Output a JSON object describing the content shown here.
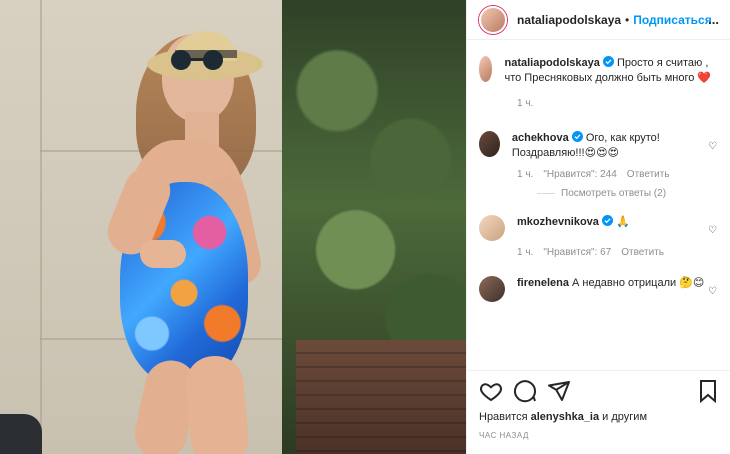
{
  "header": {
    "username": "nataliapodolskaya",
    "separator": "•",
    "follow_label": "Подписаться",
    "more": "..."
  },
  "caption": {
    "username": "nataliapodolskaya",
    "text": "Просто я считаю , что Пресняковых должно быть много ❤️",
    "time": "1 ч."
  },
  "comments": [
    {
      "username": "achekhova",
      "text": "Ого, как круто! Поздравляю!!!😍😍😍",
      "time": "1 ч.",
      "likes": "\"Нравится\": 244",
      "reply": "Ответить"
    },
    {
      "username": "mkozhevnikova",
      "text": "🙏",
      "time": "1 ч.",
      "likes": "\"Нравится\": 67",
      "reply": "Ответить"
    },
    {
      "username": "firenelena",
      "text": "А недавно отрицали 🤔😊",
      "time": "",
      "likes": "",
      "reply": ""
    }
  ],
  "view_replies": "Посмотреть ответы (2)",
  "likes_line": {
    "prefix": "Нравится",
    "user": "alenyshka_ia",
    "suffix": "и другим"
  },
  "timestamp": "ЧАС НАЗАД",
  "icons": {
    "verified": "verified-badge-icon",
    "heart": "heart-icon",
    "comment": "comment-icon",
    "share": "send-icon",
    "bookmark": "bookmark-icon"
  },
  "colors": {
    "blue": "#0095f6",
    "grey": "#8e8e8e",
    "red": "#ed4956",
    "border": "#efefef"
  }
}
